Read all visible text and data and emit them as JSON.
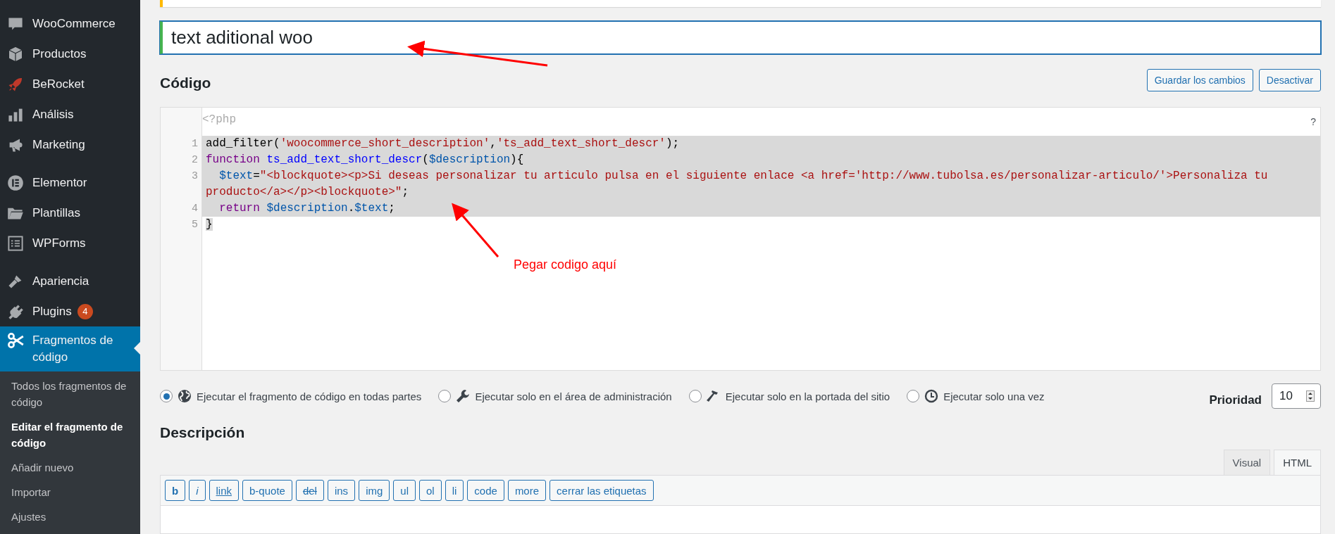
{
  "sidebar": {
    "groups": [
      {
        "items": [
          {
            "label": "WooCommerce",
            "selected": false
          },
          {
            "label": "Productos",
            "selected": false
          },
          {
            "label": "BeRocket",
            "selected": false
          },
          {
            "label": "Análisis",
            "selected": false
          },
          {
            "label": "Marketing",
            "selected": false
          }
        ]
      },
      {
        "items": [
          {
            "label": "Elementor",
            "selected": false
          },
          {
            "label": "Plantillas",
            "selected": false
          },
          {
            "label": "WPForms",
            "selected": false
          }
        ]
      },
      {
        "items": [
          {
            "label": "Apariencia",
            "selected": false
          },
          {
            "label": "Plugins",
            "badge": "4",
            "selected": false
          },
          {
            "label": "Fragmentos de código",
            "selected": true
          }
        ]
      }
    ],
    "submenu": [
      {
        "label": "Todos los fragmentos de código",
        "selected": false
      },
      {
        "label": "Editar el fragmento de código",
        "selected": true
      },
      {
        "label": "Añadir nuevo",
        "selected": false
      },
      {
        "label": "Importar",
        "selected": false
      },
      {
        "label": "Ajustes",
        "selected": false
      }
    ]
  },
  "title_field": {
    "value": "text aditional woo"
  },
  "code_section": {
    "heading": "Código",
    "buttons": [
      "Guardar los cambios",
      "Desactivar"
    ],
    "help": "?",
    "header": "<?php",
    "lines": [
      {
        "number": "1",
        "selected": true,
        "tokens": [
          {
            "kind": "plain",
            "text": "add_filter("
          },
          {
            "kind": "string",
            "text": "'woocommerce_short_description'"
          },
          {
            "kind": "plain",
            "text": ","
          },
          {
            "kind": "string",
            "text": "'ts_add_text_short_descr'"
          },
          {
            "kind": "plain",
            "text": ");"
          }
        ]
      },
      {
        "number": "2",
        "selected": true,
        "tokens": [
          {
            "kind": "keyword",
            "text": "function "
          },
          {
            "kind": "def",
            "text": "ts_add_text_short_descr"
          },
          {
            "kind": "plain",
            "text": "("
          },
          {
            "kind": "variable",
            "text": "$description"
          },
          {
            "kind": "plain",
            "text": "){"
          }
        ]
      },
      {
        "number": "3",
        "selected": true,
        "indented": true,
        "tokens": [
          {
            "kind": "variable",
            "text": "$text"
          },
          {
            "kind": "plain",
            "text": "="
          },
          {
            "kind": "string",
            "text": "\"<blockquote><p>Si deseas personalizar tu articulo pulsa en el siguiente enlace <a href='http://www.tubolsa.es/personalizar-articulo/'>Personaliza tu producto</a></p><blockquote>\""
          },
          {
            "kind": "plain",
            "text": ";"
          }
        ]
      },
      {
        "number": "4",
        "selected": true,
        "indented": true,
        "tokens": [
          {
            "kind": "keyword",
            "text": "return "
          },
          {
            "kind": "variable",
            "text": "$description"
          },
          {
            "kind": "plain",
            "text": "."
          },
          {
            "kind": "variable",
            "text": "$text"
          },
          {
            "kind": "plain",
            "text": ";"
          }
        ]
      },
      {
        "number": "5",
        "selected": true,
        "tokens": [
          {
            "kind": "plain",
            "text": "}"
          }
        ]
      }
    ]
  },
  "scope_options": [
    {
      "kind": "globe",
      "label": "Ejecutar el fragmento de código en todas partes",
      "selected": true
    },
    {
      "kind": "wrench",
      "label": "Ejecutar solo en el área de administración",
      "selected": false
    },
    {
      "kind": "hammer",
      "label": "Ejecutar solo en la portada del sitio",
      "selected": false
    },
    {
      "kind": "clock",
      "label": "Ejecutar solo una vez",
      "selected": false
    }
  ],
  "priority": {
    "label": "Prioridad",
    "value": "10"
  },
  "description": {
    "heading": "Descripción",
    "tabs": [
      {
        "label": "Visual",
        "selected": false
      },
      {
        "label": "HTML",
        "selected": true
      }
    ],
    "quicktags": [
      {
        "kind": "bold",
        "label": "b"
      },
      {
        "kind": "italic",
        "label": "i"
      },
      {
        "kind": "underline",
        "label": "link"
      },
      {
        "kind": "plain",
        "label": "b-quote"
      },
      {
        "kind": "strike",
        "label": "del"
      },
      {
        "kind": "plain",
        "label": "ins"
      },
      {
        "kind": "plain",
        "label": "img"
      },
      {
        "kind": "plain",
        "label": "ul"
      },
      {
        "kind": "plain",
        "label": "ol"
      },
      {
        "kind": "plain",
        "label": "li"
      },
      {
        "kind": "plain",
        "label": "code"
      },
      {
        "kind": "plain",
        "label": "more"
      },
      {
        "kind": "plain",
        "label": "cerrar las etiquetas"
      }
    ]
  },
  "annotation": {
    "text": "Pegar codigo aquí"
  }
}
